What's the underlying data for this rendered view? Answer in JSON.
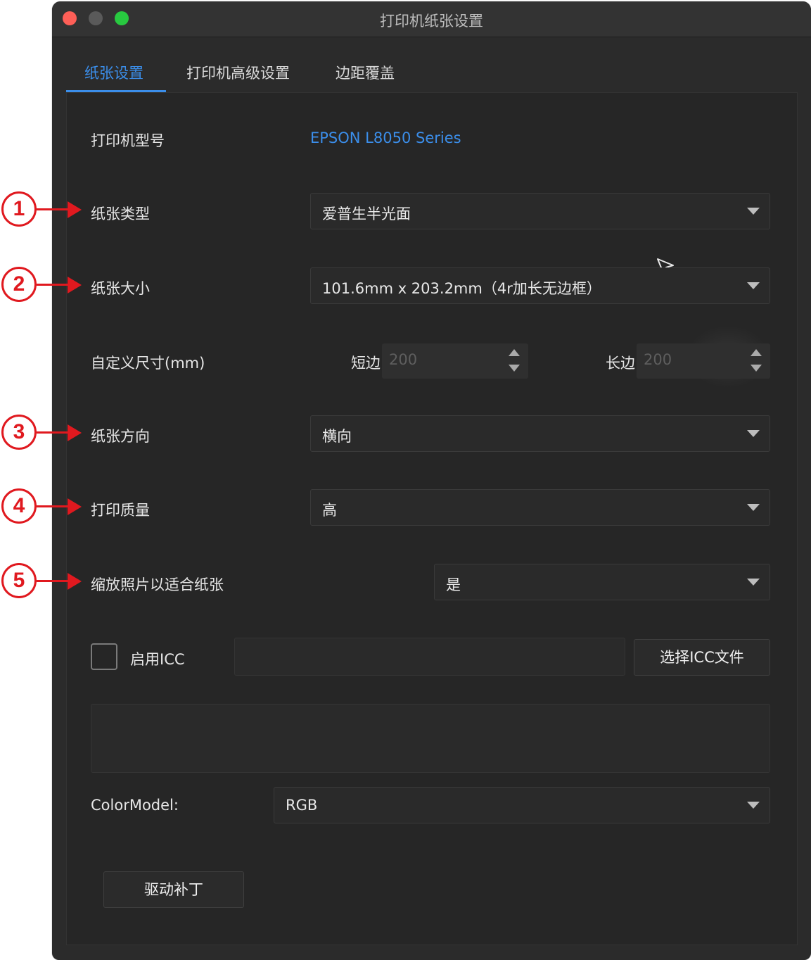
{
  "window": {
    "title": "打印机纸张设置"
  },
  "tabs": [
    {
      "label": "纸张设置",
      "active": true
    },
    {
      "label": "打印机高级设置",
      "active": false
    },
    {
      "label": "边距覆盖",
      "active": false
    }
  ],
  "form": {
    "printer_model_label": "打印机型号",
    "printer_model_value": "EPSON L8050 Series",
    "paper_type_label": "纸张类型",
    "paper_type_value": "爱普生半光面",
    "paper_size_label": "纸张大小",
    "paper_size_value": "101.6mm x 203.2mm（4r加长无边框）",
    "custom_size_label": "自定义尺寸(mm)",
    "short_side_label": "短边",
    "short_side_value": "200",
    "long_side_label": "长边",
    "long_side_value": "200",
    "orientation_label": "纸张方向",
    "orientation_value": "横向",
    "quality_label": "打印质量",
    "quality_value": "高",
    "scale_label": "缩放照片以适合纸张",
    "scale_value": "是",
    "icc_enable_label": "启用ICC",
    "icc_checked": false,
    "icc_path_value": "",
    "icc_select_button": "选择ICC文件",
    "color_model_label": "ColorModel:",
    "color_model_value": "RGB",
    "driver_patch_button": "驱动补丁"
  },
  "callouts": [
    "1",
    "2",
    "3",
    "4",
    "5"
  ],
  "colors": {
    "accent": "#3b8eea",
    "callout": "#e0191f",
    "background": "#2b2b2b"
  }
}
